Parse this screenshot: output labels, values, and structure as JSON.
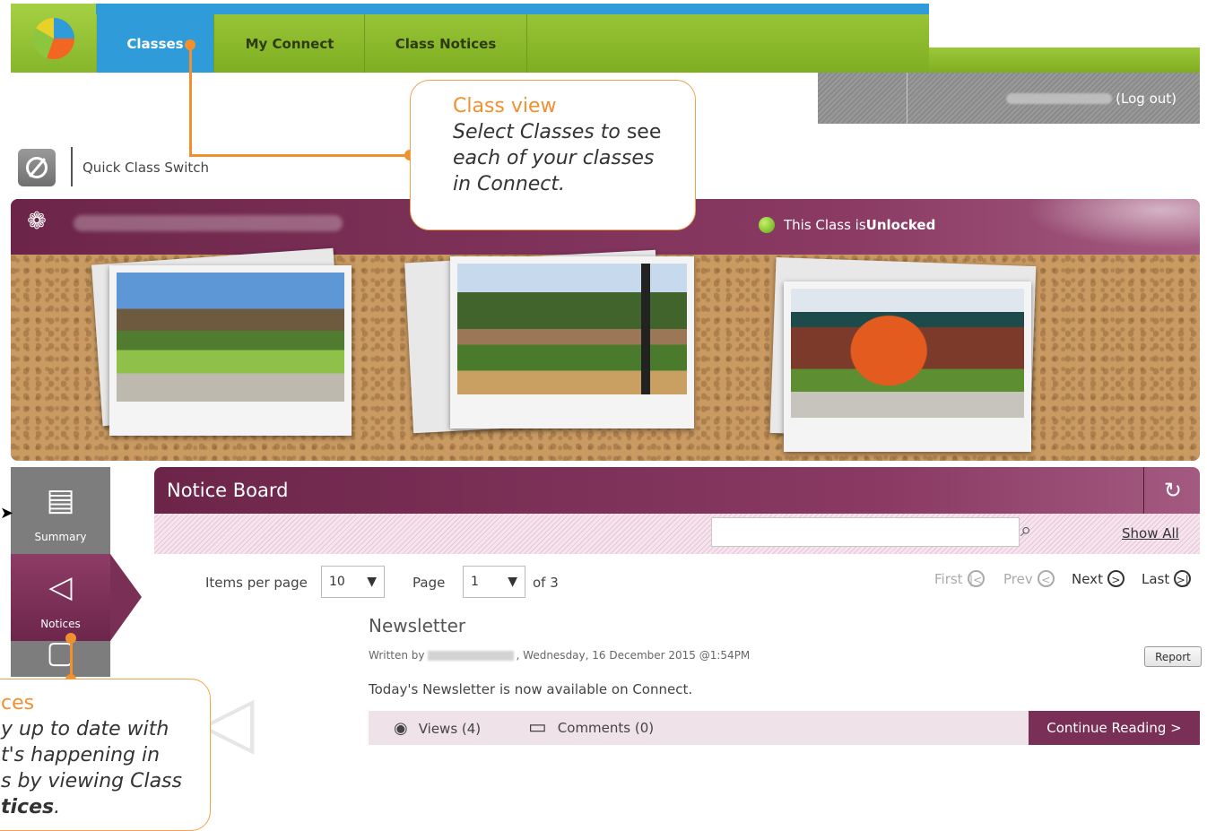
{
  "nav": {
    "tabs": [
      {
        "label": "Classes",
        "active": true
      },
      {
        "label": "My Connect",
        "active": false
      },
      {
        "label": "Class Notices",
        "active": false
      }
    ],
    "colors": {
      "bar": "#8cc63f",
      "active": "#2f9bd8"
    }
  },
  "user": {
    "logout_label": "(Log out)"
  },
  "quick_switch": {
    "label": "Quick Class Switch"
  },
  "class_banner": {
    "status_prefix": "This Class is ",
    "status_value": "Unlocked",
    "color": "#7a2f56"
  },
  "sidebar": {
    "items": [
      {
        "label": "Summary",
        "icon": "document-icon"
      },
      {
        "label": "Notices",
        "icon": "megaphone-icon",
        "active": true
      },
      {
        "label": "",
        "icon": "frame-icon"
      }
    ]
  },
  "notice_board": {
    "title": "Notice Board",
    "search": {
      "value": "",
      "placeholder": ""
    },
    "show_all_label": "Show All"
  },
  "pagination": {
    "items_per_page_label": "Items per page",
    "items_per_page_value": "10",
    "page_label": "Page",
    "page_value": "1",
    "of_label": "of 3",
    "first_label": "First",
    "prev_label": "Prev",
    "next_label": "Next",
    "last_label": "Last"
  },
  "notice": {
    "title": "Newsletter",
    "written_by_label": "Written by",
    "date": ", Wednesday, 16 December 2015 @1:54PM",
    "report_label": "Report",
    "body": "Today's Newsletter is now available on Connect.",
    "views_label": "Views (4)",
    "comments_label": "Comments (0)",
    "continue_label": "Continue Reading >"
  },
  "callouts": {
    "class_view": {
      "title": "Class view",
      "line1_italic": "Select Classes to",
      "line1_rest": " see",
      "line2": "each of your classes",
      "line3": "in Connect."
    },
    "notices": {
      "title": "ces",
      "line1": "y up to date with",
      "line2": "t's happening in",
      "line3": "s by viewing Class",
      "line4_bold": "tices",
      "line4_rest": "."
    }
  }
}
